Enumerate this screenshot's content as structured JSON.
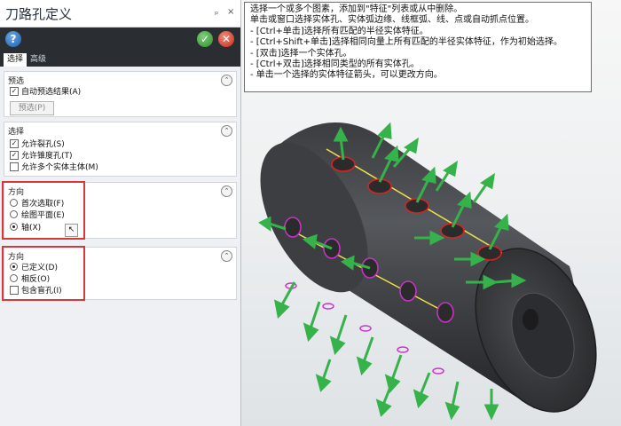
{
  "window": {
    "title": "刀路孔定义",
    "pin": "ₚ",
    "close": "×"
  },
  "toolbar": {
    "help": "?",
    "ok": "✓",
    "cancel": "✕"
  },
  "tabs": [
    {
      "label": "选择"
    },
    {
      "label": "高级"
    }
  ],
  "sections": {
    "preview": {
      "title": "预选",
      "auto_preview": "自动预选结果(A)",
      "preview_button": "预选(P)"
    },
    "select": {
      "title": "选择",
      "items": [
        {
          "label": "允许裂孔(S)",
          "checked": true
        },
        {
          "label": "允许锥度孔(T)",
          "checked": true
        },
        {
          "label": "允许多个实体主体(M)",
          "checked": false
        }
      ]
    },
    "direction1": {
      "title": "方向",
      "options": [
        {
          "label": "首次选取(F)",
          "selected": false
        },
        {
          "label": "绘图平面(E)",
          "selected": false
        },
        {
          "label": "轴(X)",
          "selected": true
        }
      ]
    },
    "direction2": {
      "title": "方向",
      "options": [
        {
          "label": "已定义(D)",
          "selected": true
        },
        {
          "label": "相反(O)",
          "selected": false
        }
      ],
      "include_blind": "包含盲孔(I)"
    }
  },
  "tooltip": {
    "lines": [
      "选择一个或多个图素，添加到\"特征\"列表或从中删除。",
      "单击或窗口选择实体孔、实体弧边缘、线框弧、线、点或自动抓点位置。",
      "- [Ctrl+单击]选择所有匹配的半径实体特征。",
      "- [Ctrl+Shift+单击]选择相同向量上所有匹配的半径实体特征，作为初始选择。",
      "- [双击]选择一个实体孔。",
      "- [Ctrl+双击]选择相同类型的所有实体孔。",
      "- 单击一个选择的实体特征箭头，可以更改方向。"
    ]
  },
  "colors": {
    "highlight_box": "#d7383b",
    "arrow_green": "#36b24a",
    "axis_yellow": "#f2e04a"
  }
}
